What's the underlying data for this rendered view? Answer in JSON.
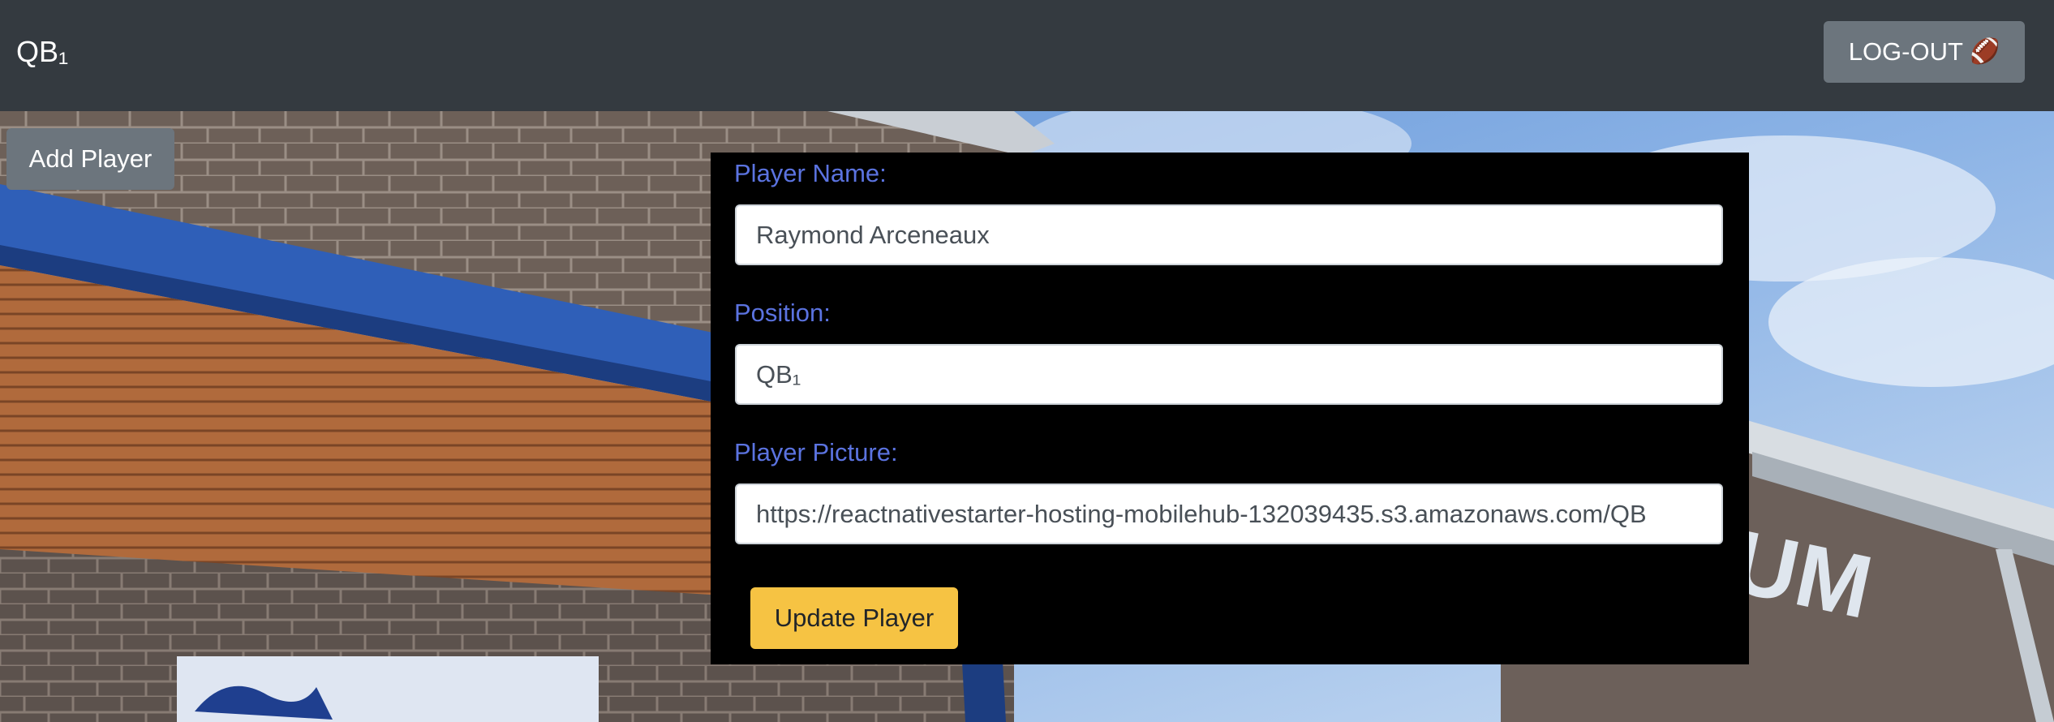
{
  "navbar": {
    "brand": "QB₁",
    "logout_label": "LOG-OUT",
    "logout_icon": "football-icon"
  },
  "add_player": {
    "label": "Add Player"
  },
  "form": {
    "name_label": "Player Name:",
    "name_value": "Raymond Arceneaux",
    "position_label": "Position:",
    "position_value": "QB₁",
    "picture_label": "Player Picture:",
    "picture_value": "https://reactnativestarter-hosting-mobilehub-132039435.s3.amazonaws.com/QB",
    "submit_label": "Update Player"
  },
  "background": {
    "sign_text": "UM"
  },
  "colors": {
    "navbar_bg": "#343a40",
    "secondary_button": "#6c757d",
    "label_blue": "#5b73e0",
    "warning_yellow": "#f6c343",
    "panel_bg": "#000000"
  }
}
